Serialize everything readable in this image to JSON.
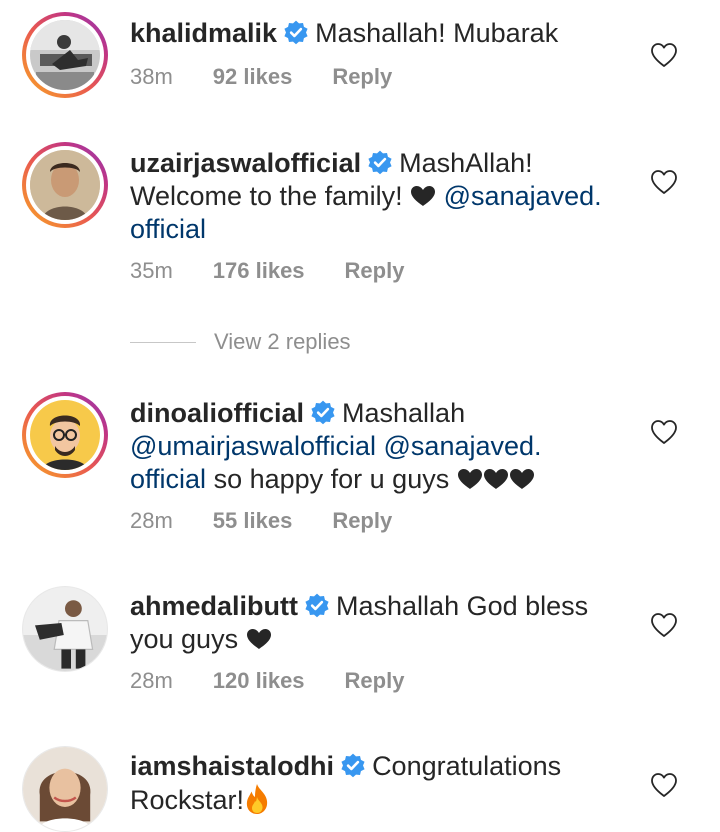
{
  "comments": [
    {
      "username": "khalidmalik",
      "text_parts": [
        "Mashallah! Mubarak"
      ],
      "time": "38m",
      "likes": "92 likes",
      "reply": "Reply"
    },
    {
      "username": "uzairjaswalofficial",
      "text_parts": [
        "MashAllah!",
        "Welcome to the family!",
        "@sanajaved.",
        "official"
      ],
      "time": "35m",
      "likes": "176 likes",
      "reply": "Reply"
    },
    {
      "username": "dinoaliofficial",
      "text_parts": [
        "Mashallah",
        "@umairjaswalofficial",
        "@sanajaved.",
        "official",
        "so happy for u guys"
      ],
      "time": "28m",
      "likes": "55 likes",
      "reply": "Reply"
    },
    {
      "username": "ahmedalibutt",
      "text_parts": [
        "Mashallah God bless",
        "you guys"
      ],
      "time": "28m",
      "likes": "120 likes",
      "reply": "Reply"
    },
    {
      "username": "iamshaistalodhi",
      "text_parts": [
        "Congratulations",
        "Rockstar!"
      ]
    }
  ],
  "view_replies": "View 2 replies",
  "colors": {
    "verified": "#3897f0",
    "mention": "#00376b",
    "meta": "#8e8e8e"
  },
  "icons": [
    "verified-badge-icon",
    "heart-outline-icon",
    "heart-emoji",
    "fire-emoji"
  ]
}
